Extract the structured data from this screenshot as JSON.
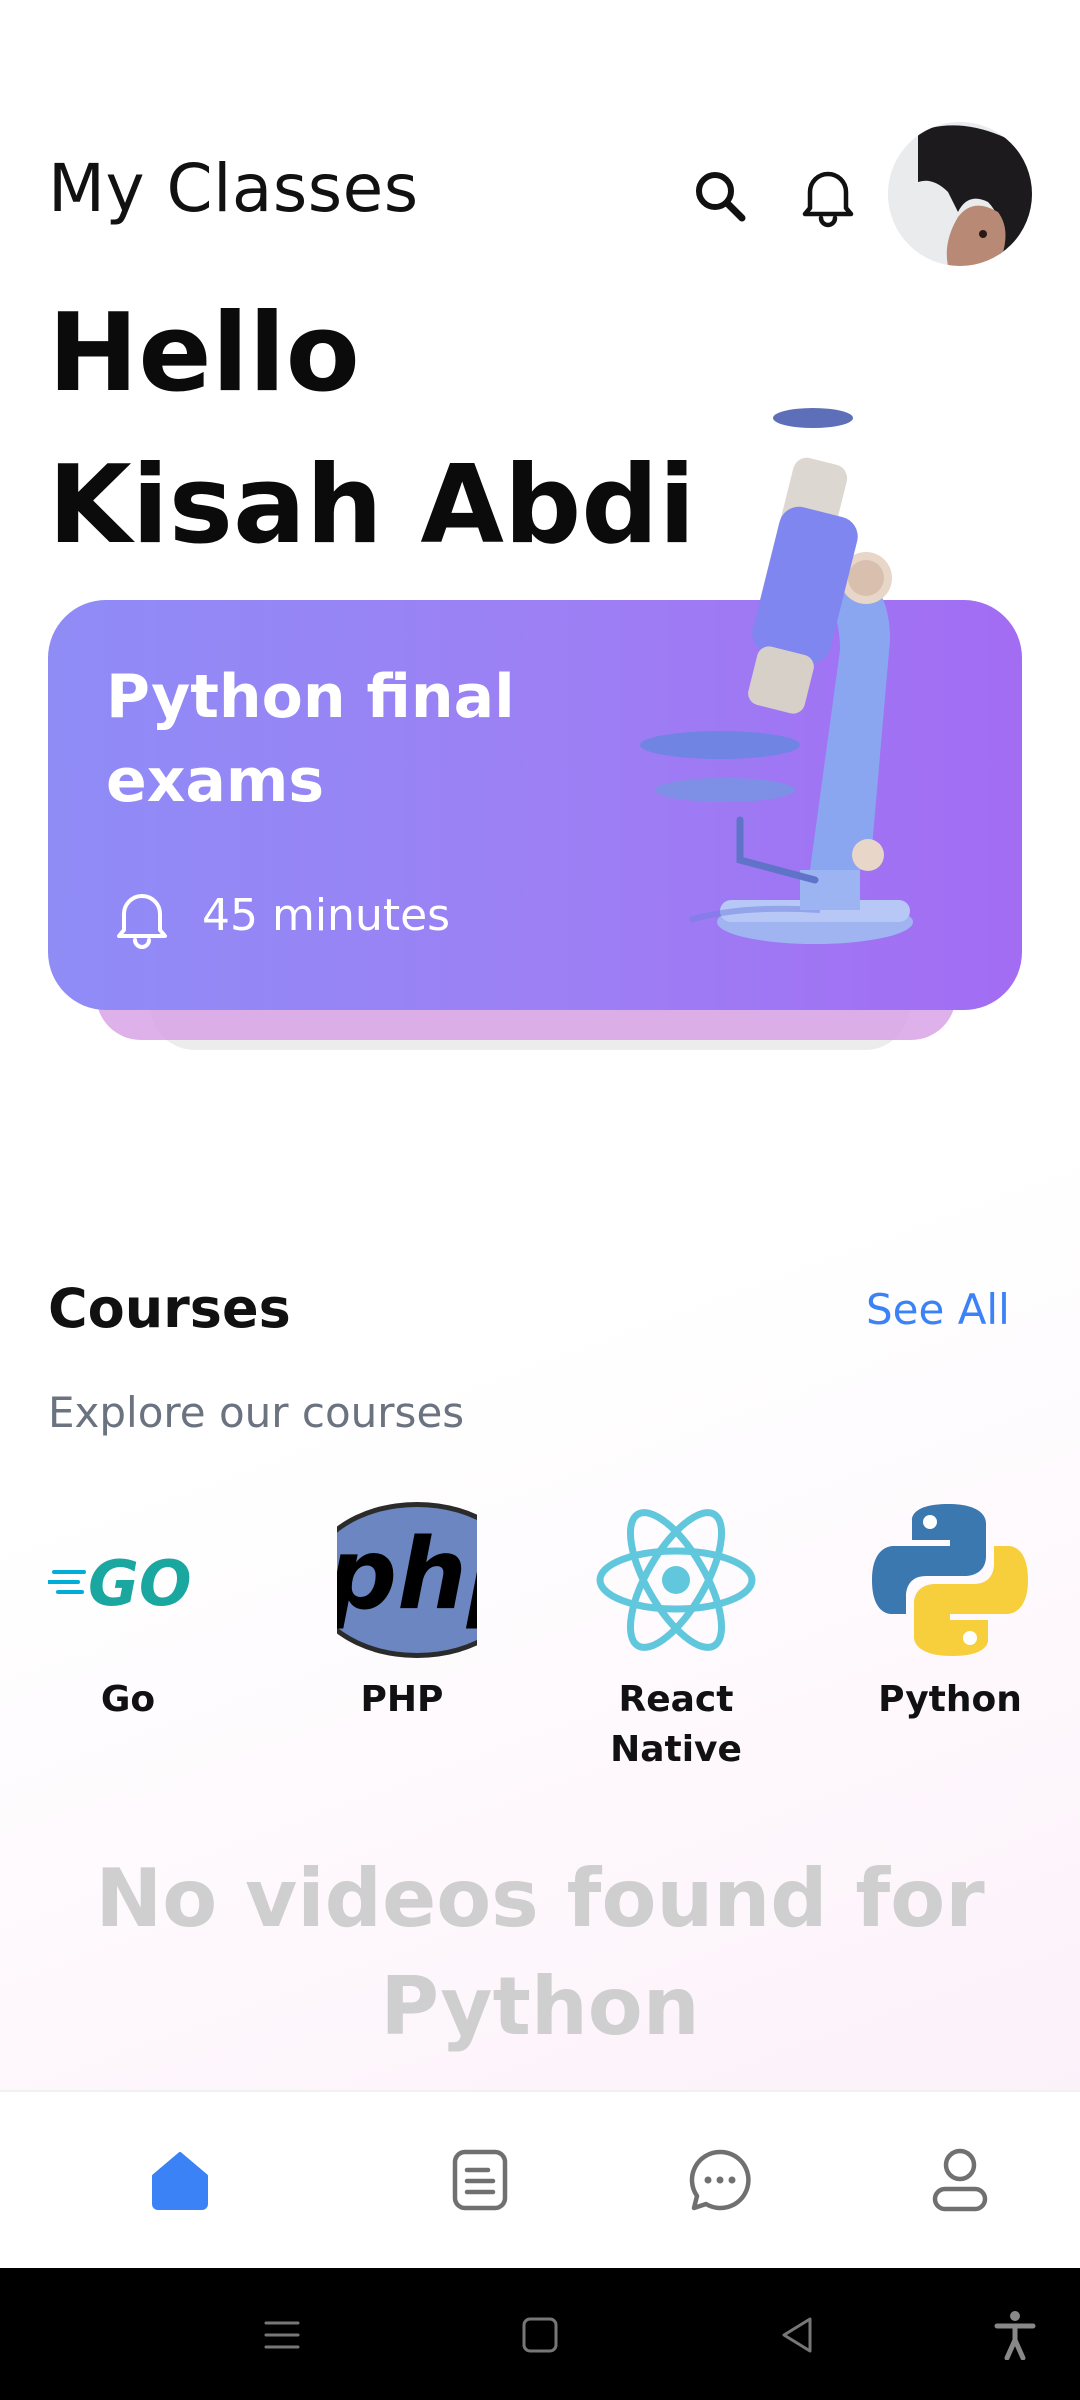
{
  "header": {
    "title": "My Classes",
    "icons": {
      "search": "search-icon",
      "notifications": "bell-icon",
      "avatar": "user-avatar"
    }
  },
  "greeting": {
    "line1": "Hello",
    "line2": "Kisah Abdi"
  },
  "exam_card": {
    "title": "Python final exams",
    "duration": "45 minutes",
    "icons": {
      "duration": "bell-icon",
      "illustration": "microscope-illustration"
    },
    "colors": {
      "gradient_start": "#8f8cf6",
      "gradient_end": "#a26cf3"
    }
  },
  "courses": {
    "title": "Courses",
    "see_all": "See All",
    "subtitle": "Explore our courses",
    "items": [
      {
        "label": "Go",
        "icon": "go-logo"
      },
      {
        "label": "PHP",
        "icon": "php-logo"
      },
      {
        "label": "React Native",
        "icon": "react-logo"
      },
      {
        "label": "Python",
        "icon": "python-logo"
      }
    ]
  },
  "videos": {
    "empty_message": "No videos found for Python"
  },
  "bottom_nav": {
    "items": [
      {
        "icon": "home-icon",
        "active": true
      },
      {
        "icon": "document-icon",
        "active": false
      },
      {
        "icon": "chat-icon",
        "active": false
      },
      {
        "icon": "profile-icon",
        "active": false
      }
    ],
    "colors": {
      "active": "#3b82f6",
      "inactive": "#707070"
    }
  },
  "system_nav": {
    "icons": [
      "menu-icon",
      "home-square-icon",
      "back-triangle-icon",
      "accessibility-icon"
    ]
  }
}
